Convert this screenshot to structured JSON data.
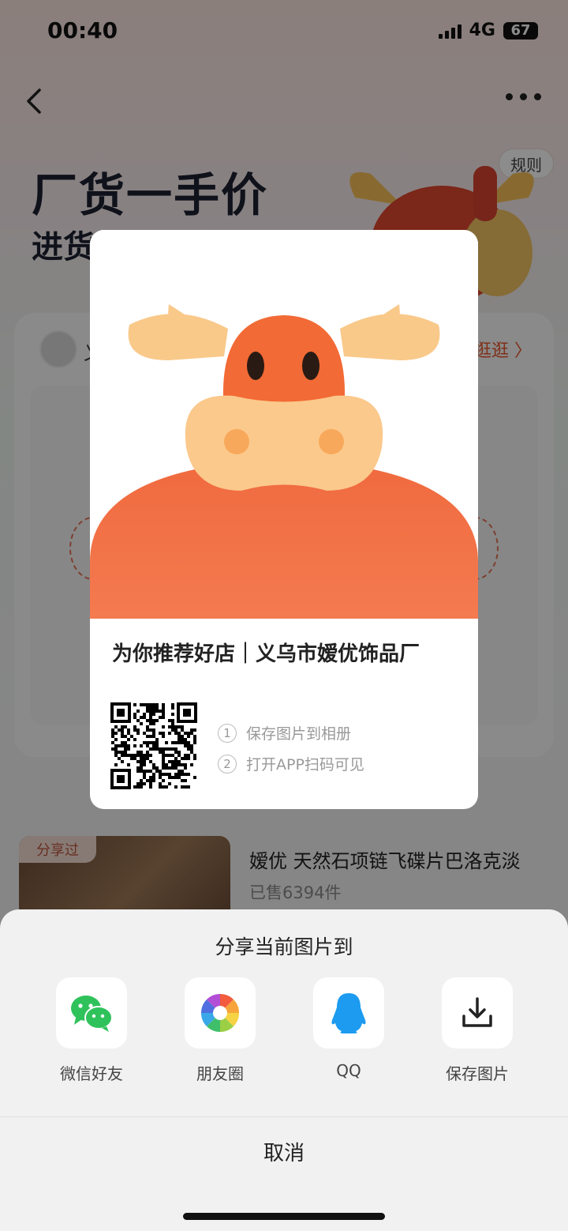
{
  "status_bar": {
    "time": "00:40",
    "network": "4G",
    "battery": "67"
  },
  "banner": {
    "title": "厂货一手价",
    "subtitle": "进货",
    "rule_label": "规则"
  },
  "shop": {
    "name_partial": "义",
    "visit_label": "店逛逛 〉"
  },
  "product": {
    "shared_tag": "分享过",
    "title": "嫒优 天然石项链飞碟片巴洛克淡",
    "sold": "已售6394件"
  },
  "poster": {
    "title": "为你推荐好店｜义乌市嫒优饰品厂",
    "steps": [
      {
        "num": "1",
        "text": "保存图片到相册"
      },
      {
        "num": "2",
        "text": "打开APP扫码可见"
      }
    ]
  },
  "share_sheet": {
    "title": "分享当前图片到",
    "options": [
      {
        "label": "微信好友",
        "icon": "wechat-icon"
      },
      {
        "label": "朋友圈",
        "icon": "moments-icon"
      },
      {
        "label": "QQ",
        "icon": "qq-icon"
      },
      {
        "label": "保存图片",
        "icon": "download-icon"
      }
    ],
    "cancel_label": "取消"
  }
}
